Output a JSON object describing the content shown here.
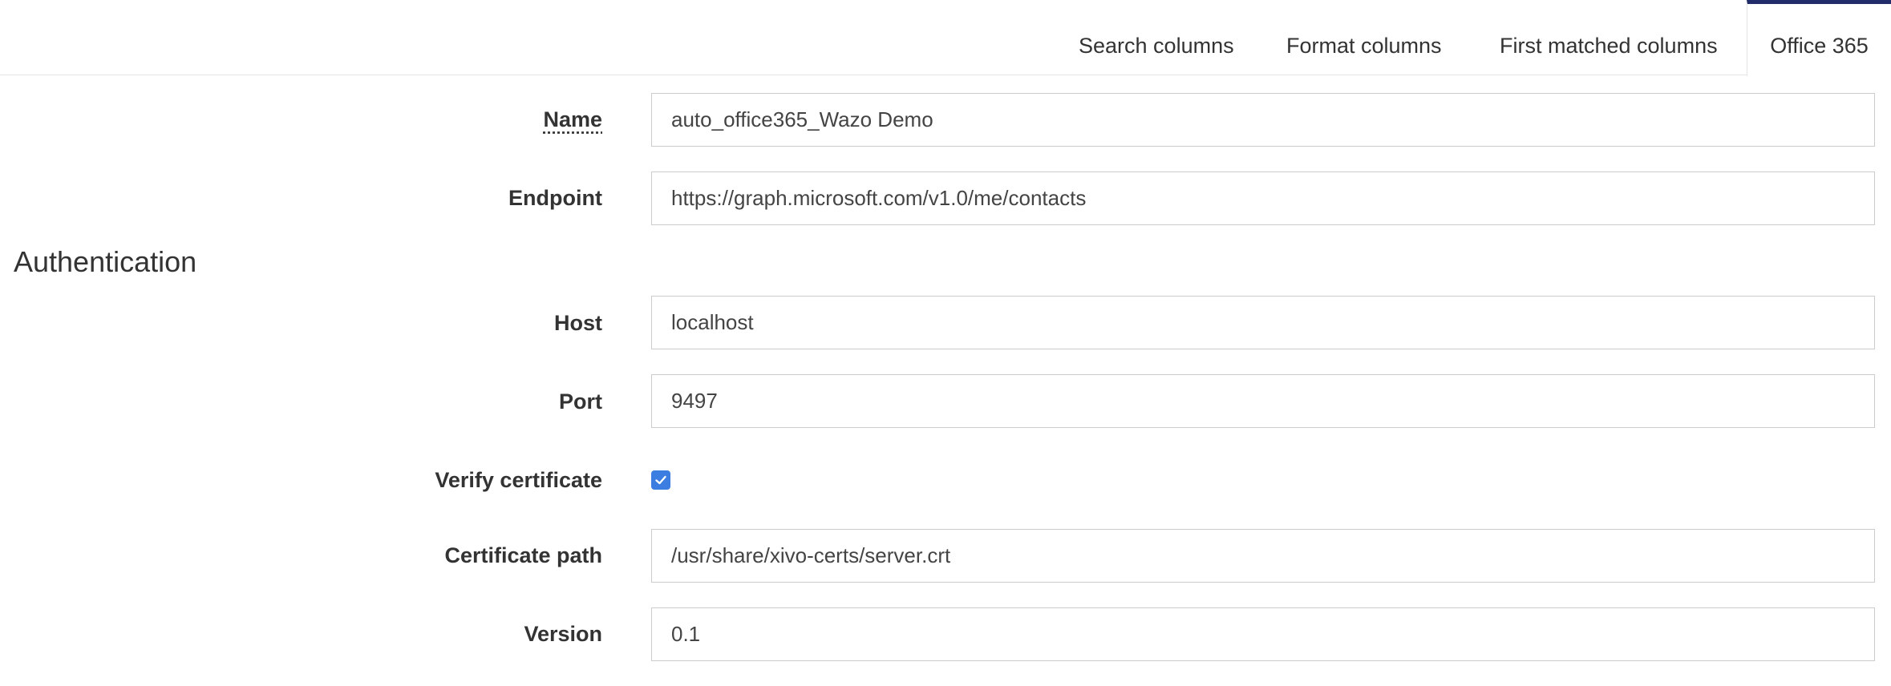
{
  "tabs": [
    {
      "label": "Search columns",
      "active": false
    },
    {
      "label": "Format columns",
      "active": false
    },
    {
      "label": "First matched columns",
      "active": false
    },
    {
      "label": "Office 365",
      "active": true
    }
  ],
  "form": {
    "name": {
      "label": "Name",
      "value": "auto_office365_Wazo Demo"
    },
    "endpoint": {
      "label": "Endpoint",
      "value": "https://graph.microsoft.com/v1.0/me/contacts"
    }
  },
  "authentication": {
    "heading": "Authentication",
    "host": {
      "label": "Host",
      "value": "localhost"
    },
    "port": {
      "label": "Port",
      "value": "9497"
    },
    "verify_certificate": {
      "label": "Verify certificate",
      "checked": true
    },
    "certificate_path": {
      "label": "Certificate path",
      "value": "/usr/share/xivo-certs/server.crt"
    },
    "version": {
      "label": "Version",
      "value": "0.1"
    }
  },
  "colors": {
    "active_tab_border": "#232c6a",
    "checkbox_fill": "#3b7de0"
  },
  "icons": {
    "checkbox": "checkmark-icon"
  }
}
